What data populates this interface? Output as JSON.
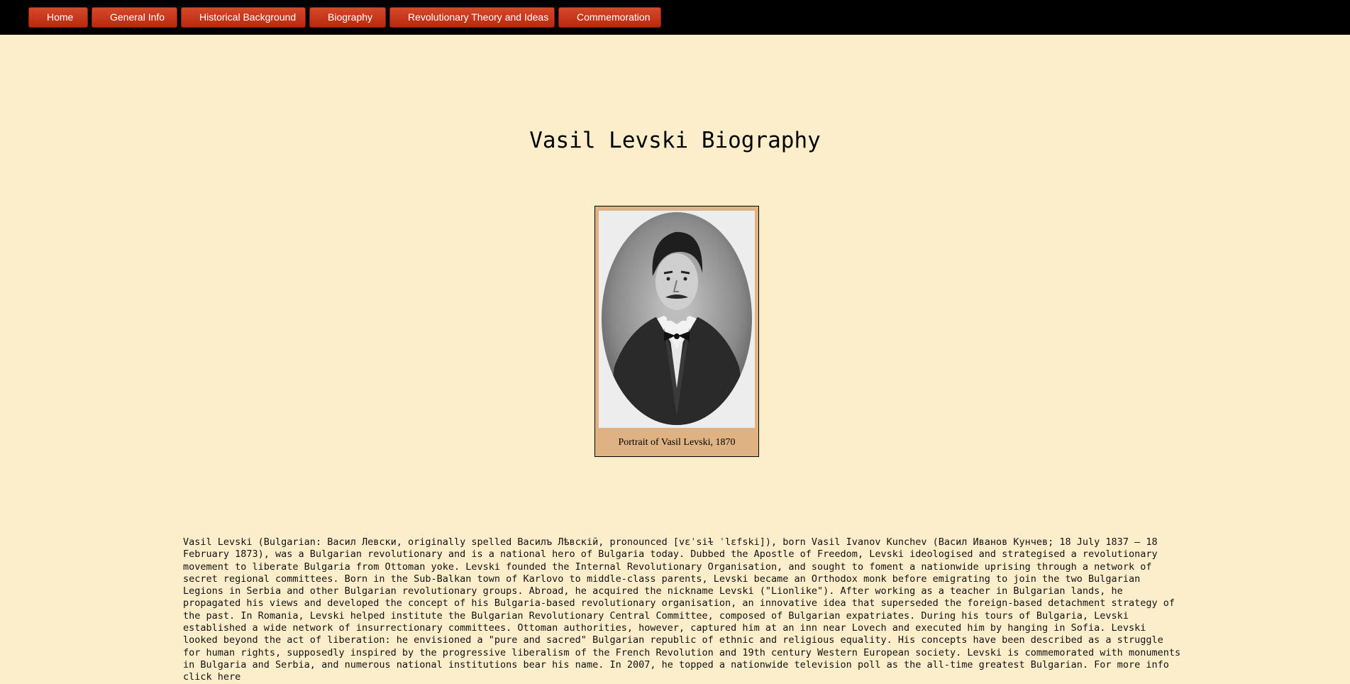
{
  "nav": {
    "items": [
      {
        "label": "Home"
      },
      {
        "label": "General Info"
      },
      {
        "label": "Historical Background"
      },
      {
        "label": "Biography"
      },
      {
        "label": "Revolutionary Theory and Ideas"
      },
      {
        "label": "Commemoration"
      }
    ]
  },
  "page": {
    "title": "Vasil Levski Biography"
  },
  "figure": {
    "caption": "Portrait of Vasil Levski, 1870"
  },
  "bio": {
    "text": "Vasil Levski (Bulgarian: Васил Левски, originally spelled Василъ Лѣвскій, pronounced [vɛˈsiɫ ˈlɛfski]), born Vasil Ivanov Kunchev (Васил Иванов Кунчев; 18 July 1837 – 18 February 1873), was a Bulgarian revolutionary and is a national hero of Bulgaria today. Dubbed the Apostle of Freedom, Levski ideologised and strategised a revolutionary movement to liberate Bulgaria from Ottoman yoke. Levski founded the Internal Revolutionary Organisation, and sought to foment a nationwide uprising through a network of secret regional committees. Born in the Sub-Balkan town of Karlovo to middle-class parents, Levski became an Orthodox monk before emigrating to join the two Bulgarian Legions in Serbia and other Bulgarian revolutionary groups. Abroad, he acquired the nickname Levski (\"Lionlike\"). After working as a teacher in Bulgarian lands, he propagated his views and developed the concept of his Bulgaria-based revolutionary organisation, an innovative idea that superseded the foreign-based detachment strategy of the past. In Romania, Levski helped institute the Bulgarian Revolutionary Central Committee, composed of Bulgarian expatriates. During his tours of Bulgaria, Levski established a wide network of insurrectionary committees. Ottoman authorities, however, captured him at an inn near Lovech and executed him by hanging in Sofia. Levski looked beyond the act of liberation: he envisioned a \"pure and sacred\" Bulgarian republic of ethnic and religious equality. His concepts have been described as a struggle for human rights, supposedly inspired by the progressive liberalism of the French Revolution and 19th century Western European society. Levski is commemorated with monuments in Bulgaria and Serbia, and numerous national institutions bear his name. In 2007, he topped a nationwide television poll as the all-time greatest Bulgarian. For more info",
    "link_label": "click here"
  }
}
